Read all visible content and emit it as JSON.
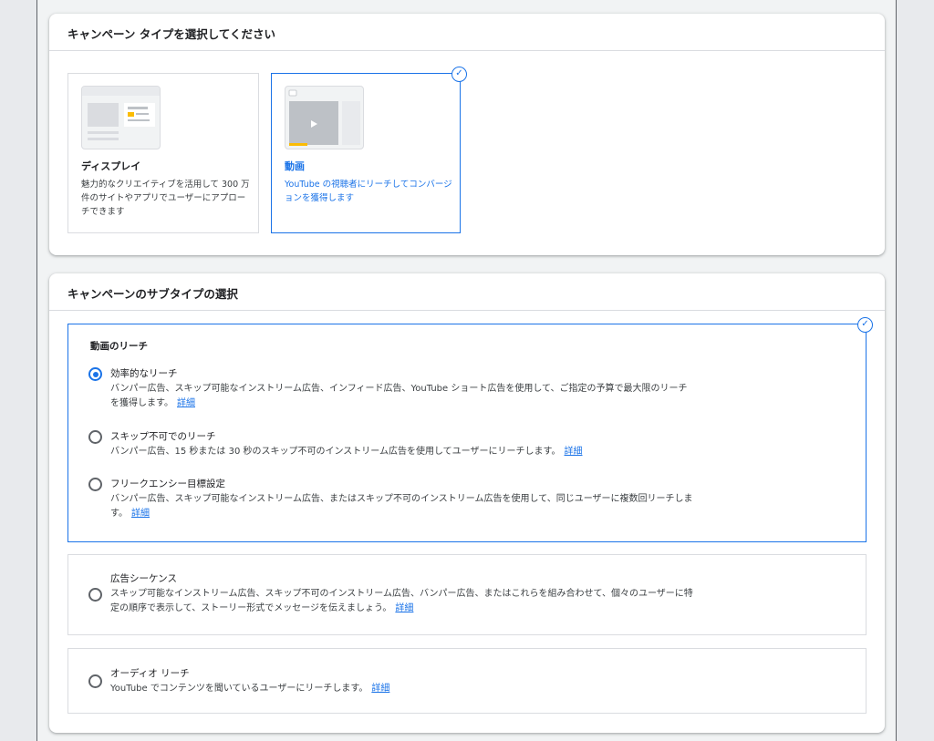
{
  "campaign_type": {
    "header": "キャンペーン タイプを選択してください",
    "tiles": [
      {
        "title": "ディスプレイ",
        "desc": "魅力的なクリエイティブを活用して 300 万件のサイトやアプリでユーザーにアプローチできます",
        "selected": false
      },
      {
        "title": "動画",
        "desc": "YouTube の視聴者にリーチしてコンバージョンを獲得します",
        "selected": true
      }
    ]
  },
  "subtype": {
    "header": "キャンペーンのサブタイプの選択",
    "reach_group": {
      "title": "動画のリーチ",
      "options": [
        {
          "label": "効率的なリーチ",
          "desc": "バンパー広告、スキップ可能なインストリーム広告、インフィード広告、YouTube ショート広告を使用して、ご指定の予算で最大限のリーチを獲得します。",
          "link": "詳細",
          "checked": true
        },
        {
          "label": "スキップ不可でのリーチ",
          "desc": "バンパー広告、15 秒または 30 秒のスキップ不可のインストリーム広告を使用してユーザーにリーチします。",
          "link": "詳細",
          "checked": false
        },
        {
          "label": "フリークエンシー目標設定",
          "desc": "バンパー広告、スキップ可能なインストリーム広告、またはスキップ不可のインストリーム広告を使用して、同じユーザーに複数回リーチします。",
          "link": "詳細",
          "checked": false
        }
      ]
    },
    "sequence": {
      "label": "広告シーケンス",
      "desc": "スキップ可能なインストリーム広告、スキップ不可のインストリーム広告、バンパー広告、またはこれらを組み合わせて、個々のユーザーに特定の順序で表示して、ストーリー形式でメッセージを伝えましょう。",
      "link": "詳細"
    },
    "audio": {
      "label": "オーディオ リーチ",
      "desc": "YouTube でコンテンツを聞いているユーザーにリーチします。",
      "link": "詳細"
    }
  },
  "colors": {
    "accent": "#1a73e8",
    "border": "#dadce0"
  }
}
